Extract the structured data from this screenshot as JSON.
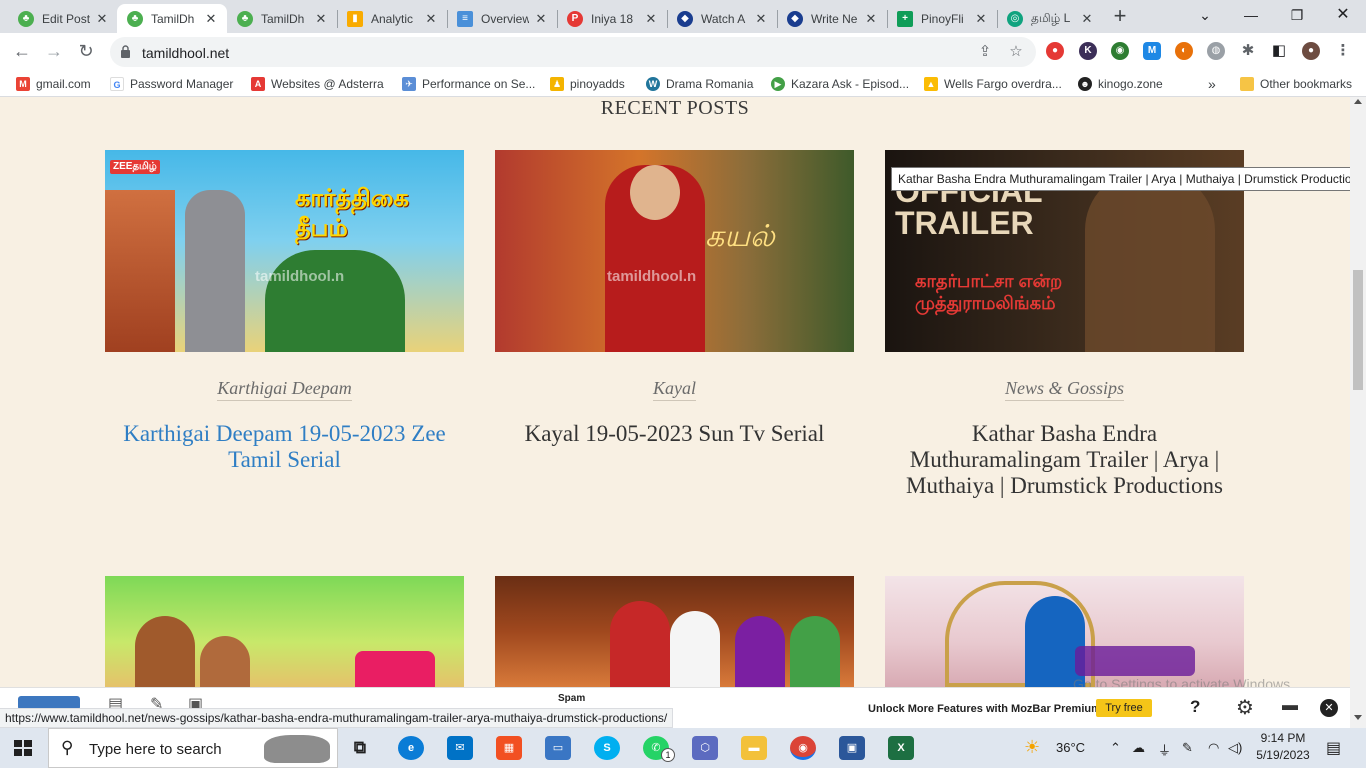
{
  "tabs": [
    {
      "label": "Edit Post",
      "active": false
    },
    {
      "label": "TamilDh",
      "active": true
    },
    {
      "label": "TamilDh",
      "active": false
    },
    {
      "label": "Analytic",
      "active": false
    },
    {
      "label": "Overview",
      "active": false
    },
    {
      "label": "Iniya 18",
      "active": false
    },
    {
      "label": "Watch A",
      "active": false
    },
    {
      "label": "Write Ne",
      "active": false
    },
    {
      "label": "PinoyFli",
      "active": false
    },
    {
      "label": "தமிழ் L",
      "active": false
    }
  ],
  "address": {
    "url": "tamildhool.net"
  },
  "bookmarks": [
    {
      "label": "gmail.com"
    },
    {
      "label": "Password Manager"
    },
    {
      "label": "Websites @ Adsterra"
    },
    {
      "label": "Performance on Se..."
    },
    {
      "label": "pinoyadds"
    },
    {
      "label": "Drama Romania"
    },
    {
      "label": "Kazara Ask - Episod..."
    },
    {
      "label": "Wells Fargo overdra..."
    },
    {
      "label": "kinogo.zone"
    },
    {
      "label": "Other bookmarks"
    }
  ],
  "bookmarks_more": "»",
  "page": {
    "section_title": "RECENT POSTS",
    "posts": [
      {
        "category": "Karthigai Deepam",
        "title": "Karthigai Deepam 19-05-2023 Zee Tamil Serial",
        "thumb_text": "கார்த்திகை தீபம்",
        "thumb_logo": "ZEEதமிழ்",
        "watermark": "tamildhool.n"
      },
      {
        "category": "Kayal",
        "title": "Kayal 19-05-2023 Sun Tv Serial",
        "thumb_text": "கயல்",
        "watermark": "tamildhool.n"
      },
      {
        "category": "News & Gossips",
        "title": "Kathar Basha Endra Muthuramalingam Trailer | Arya | Muthaiya | Drumstick Productions",
        "thumb_text": "OFFICIAL TRAILER",
        "thumb_sub": "காதர்பாட்சா என்ற முத்துராமலிங்கம்"
      }
    ]
  },
  "tooltip": "Kathar Basha Endra Muthuramalingam Trailer | Arya | Muthaiya | Drumstick Productions",
  "status_url": "https://www.tamildhool.net/news-gossips/kathar-basha-endra-muthuramalingam-trailer-arya-muthaiya-drumstick-productions/",
  "mozbar": {
    "unlock_text": "Unlock More Features with MozBar Premium",
    "try_free": "Try free",
    "spam_label": "Spam",
    "help": "?",
    "close": "✕"
  },
  "activate_windows": "Go to Settings to activate Windows.",
  "taskbar": {
    "search_placeholder": "Type here to search",
    "temperature": "36°C",
    "time": "9:14 PM",
    "date": "5/19/2023",
    "whatsapp_badge": "1"
  },
  "colors": {
    "page_bg": "#f8f0e3",
    "link_title": "#2f7ec4",
    "tabstrip_bg": "#dee1e6"
  }
}
